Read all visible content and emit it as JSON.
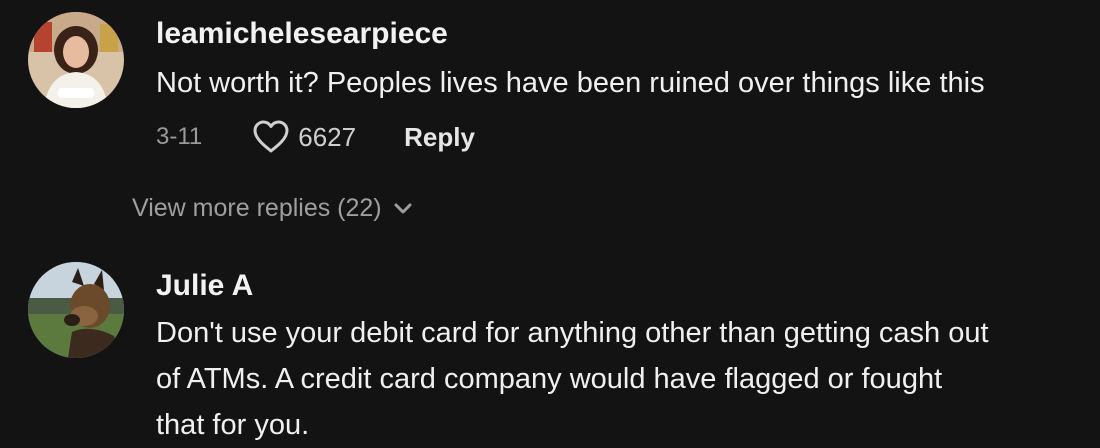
{
  "comments": [
    {
      "username": "leamichelesearpiece",
      "avatar_icon": "user-avatar-woman",
      "text_lines": [
        "Not worth it? Peoples lives have been ruined over things like this"
      ],
      "date": "3-11",
      "likes": "6627",
      "reply_label": "Reply",
      "view_more_label": "View more replies (22)"
    },
    {
      "username": "Julie A",
      "avatar_icon": "user-avatar-dog",
      "text_lines": [
        "Don't use your debit card for anything other than getting cash out",
        "of ATMs. A credit card company would have flagged or fought",
        "that for you."
      ]
    }
  ],
  "colors": {
    "background": "#131313",
    "primary_text": "#f0f0f0",
    "secondary_text": "#9a9a9a"
  }
}
